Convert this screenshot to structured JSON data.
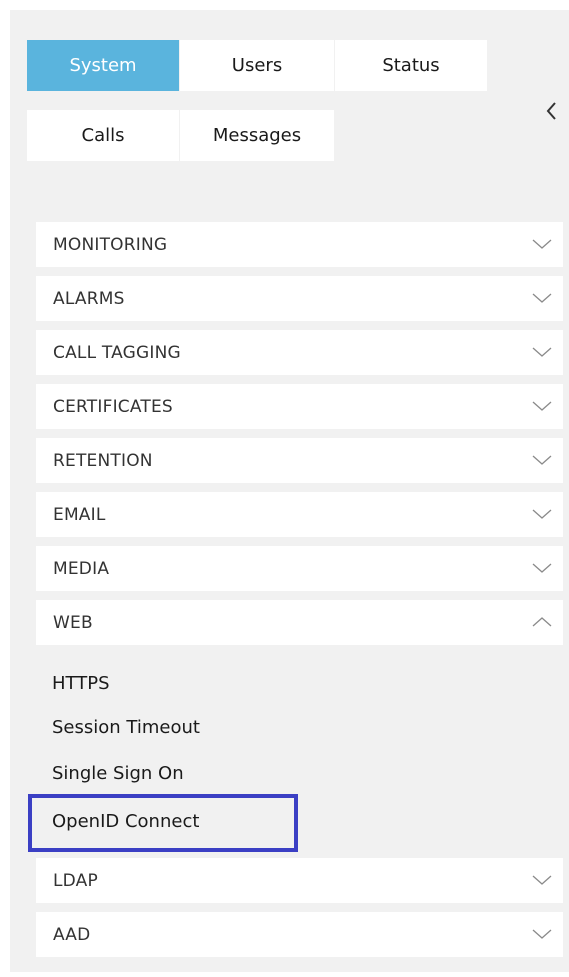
{
  "tabs": {
    "system": "System",
    "users": "Users",
    "status": "Status",
    "calls": "Calls",
    "messages": "Messages"
  },
  "sections": [
    {
      "label": "MONITORING",
      "expanded": false
    },
    {
      "label": "ALARMS",
      "expanded": false
    },
    {
      "label": "CALL TAGGING",
      "expanded": false
    },
    {
      "label": "CERTIFICATES",
      "expanded": false
    },
    {
      "label": "RETENTION",
      "expanded": false
    },
    {
      "label": "EMAIL",
      "expanded": false
    },
    {
      "label": "MEDIA",
      "expanded": false
    },
    {
      "label": "WEB",
      "expanded": true
    },
    {
      "label": "LDAP",
      "expanded": false
    },
    {
      "label": "AAD",
      "expanded": false
    }
  ],
  "web_items": [
    "HTTPS",
    "Session Timeout",
    "Single Sign On",
    "OpenID Connect"
  ],
  "colors": {
    "active_tab": "#5ab4dd",
    "highlight_border": "#3b3fc4",
    "panel_bg": "#f1f1f1"
  },
  "icons": {
    "collapse": "chevron-left-icon",
    "collapsed_section": "chevron-down-icon",
    "expanded_section": "chevron-up-icon"
  }
}
